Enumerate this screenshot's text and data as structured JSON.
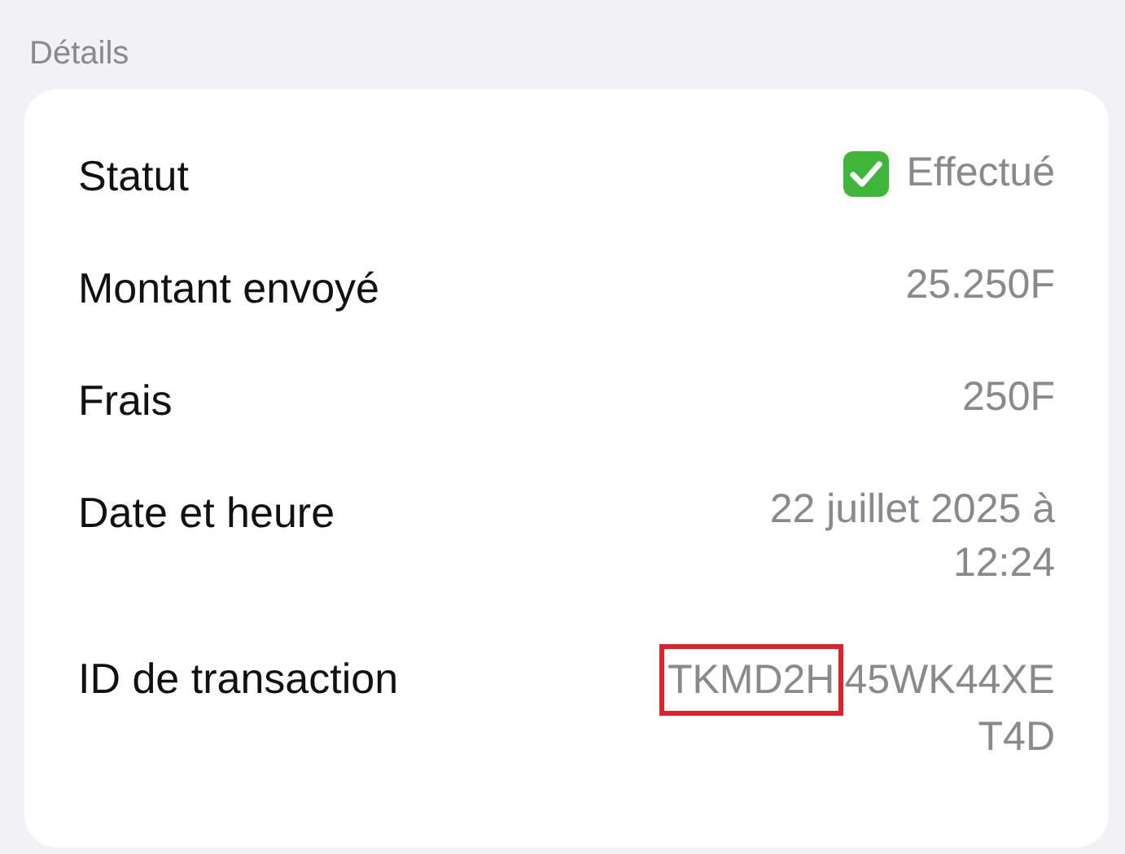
{
  "section_title": "Détails",
  "rows": [
    {
      "kind": "status",
      "label": "Statut",
      "lines": [
        [
          {
            "text": "Effectué",
            "highlighted": false
          }
        ]
      ]
    },
    {
      "kind": "plain",
      "label": "Montant envoyé",
      "lines": [
        [
          {
            "text": "25.250F",
            "highlighted": false
          }
        ]
      ]
    },
    {
      "kind": "plain",
      "label": "Frais",
      "lines": [
        [
          {
            "text": "250F",
            "highlighted": false
          }
        ]
      ]
    },
    {
      "kind": "plain",
      "label": "Date et heure",
      "lines": [
        [
          {
            "text": "22 juillet 2025 à",
            "highlighted": false
          }
        ],
        [
          {
            "text": "12:24",
            "highlighted": false
          }
        ]
      ]
    },
    {
      "kind": "plain",
      "label": "ID de transaction",
      "lines": [
        [
          {
            "text": "TKMD2H",
            "highlighted": true
          },
          {
            "text": "45WK44XE",
            "highlighted": false
          }
        ],
        [
          {
            "text": "T4D",
            "highlighted": false
          }
        ]
      ]
    }
  ]
}
